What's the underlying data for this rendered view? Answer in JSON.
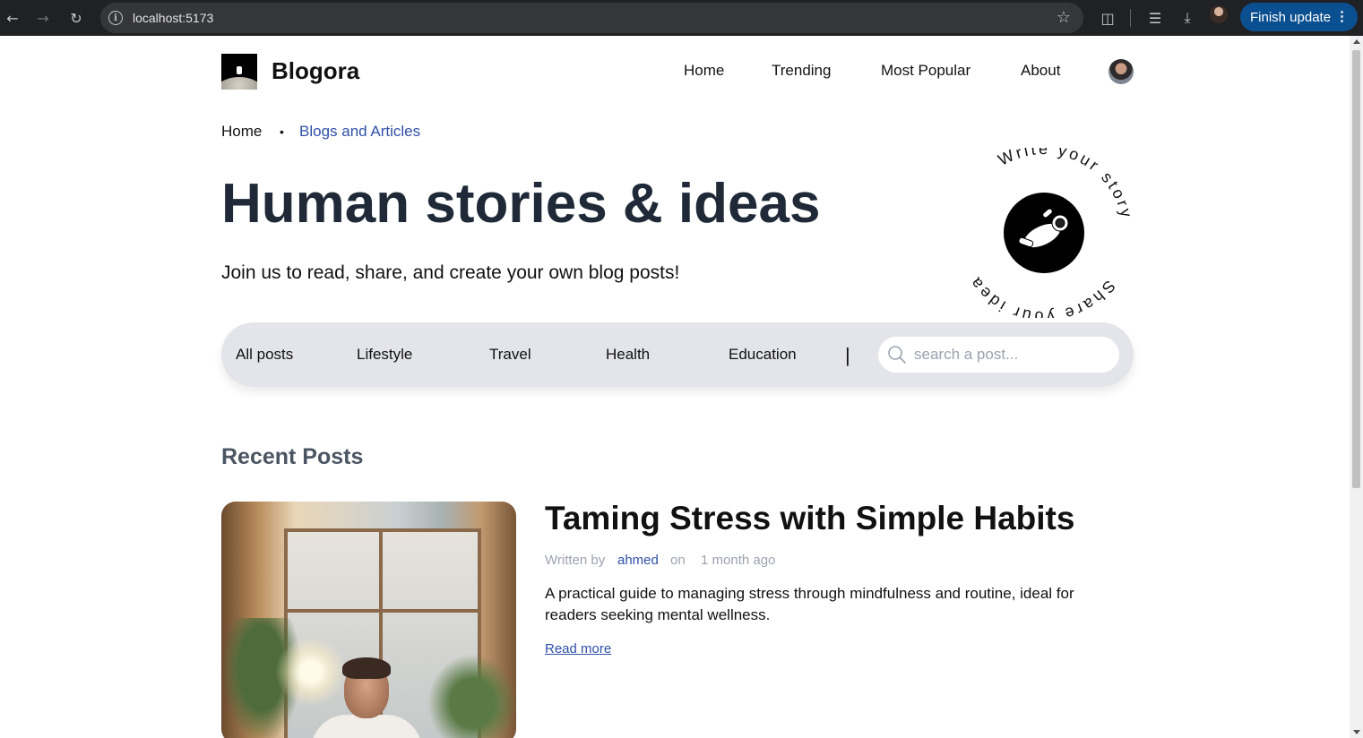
{
  "browser": {
    "url": "localhost:5173",
    "finish_update_label": "Finish update"
  },
  "site": {
    "logo_text": "Blogora",
    "nav": [
      "Home",
      "Trending",
      "Most Popular",
      "About"
    ]
  },
  "breadcrumb": {
    "home": "Home",
    "separator": "•",
    "current": "Blogs and Articles"
  },
  "hero": {
    "title": "Human stories & ideas",
    "subtitle": "Join us to read, share, and create your own blog posts!",
    "badge_text_top": "Write your story",
    "badge_text_bottom": "Share your idea"
  },
  "filters": {
    "items": [
      "All posts",
      "Lifestyle",
      "Travel",
      "Health",
      "Education"
    ],
    "separator": "|",
    "search_placeholder": "search a post..."
  },
  "recent": {
    "heading": "Recent Posts",
    "post": {
      "title": "Taming Stress with Simple Habits",
      "written_by": "Written by",
      "author": "ahmed",
      "on": "on",
      "date": "1 month ago",
      "description": "A practical guide to managing stress through mindfulness and routine, ideal for readers seeking mental wellness.",
      "read_more": "Read more"
    }
  },
  "colors": {
    "accent": "#2f50a8",
    "title": "#1f2937",
    "filter_bar": "#e4e5ea"
  }
}
